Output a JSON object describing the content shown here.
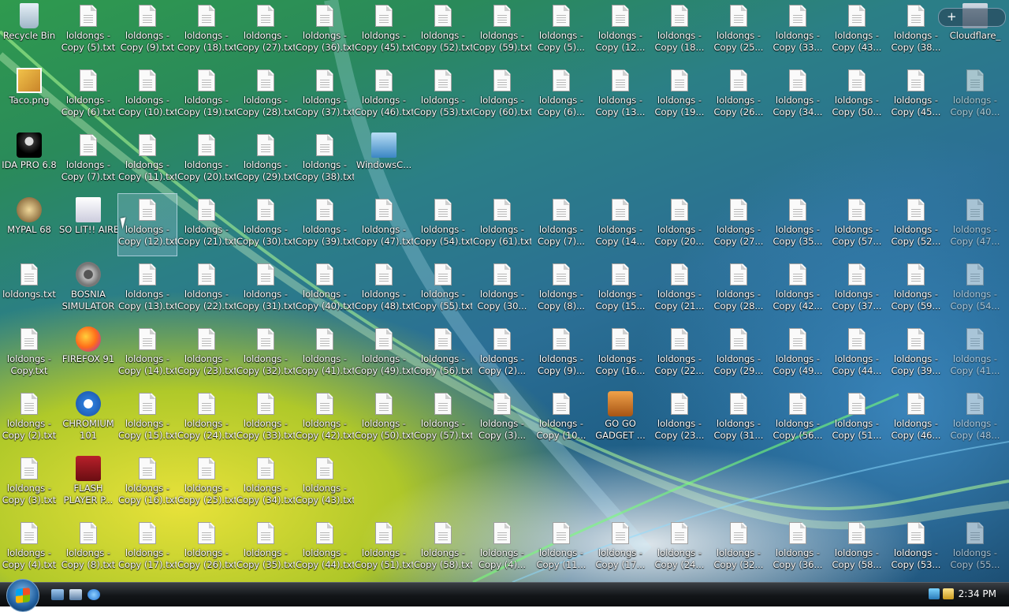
{
  "desktop": {
    "special_icons": [
      {
        "label": "Recycle Bin",
        "icon": "recycle-bin-icon",
        "col": 0,
        "row": 0
      },
      {
        "label": "Taco.png",
        "icon": "taco-image-icon",
        "col": 0,
        "row": 1
      },
      {
        "label": "IDA PRO 6.8",
        "icon": "ida-pro-icon",
        "col": 0,
        "row": 2
      },
      {
        "label": "MYPAL 68",
        "icon": "mypal-browser-icon",
        "col": 0,
        "row": 3
      },
      {
        "label": "SO LIT!! AIRE",
        "icon": "shortcut-app-icon",
        "col": 1,
        "row": 3
      },
      {
        "label": "BOSNIA\nSIMULATOR",
        "icon": "gear-app-icon",
        "col": 1,
        "row": 4
      },
      {
        "label": "FIREFOX 91",
        "icon": "firefox-icon",
        "col": 1,
        "row": 5
      },
      {
        "label": "CHROMIUM\n101",
        "icon": "chromium-icon",
        "col": 1,
        "row": 6
      },
      {
        "label": "FLASH\nPLAYER P...",
        "icon": "flash-player-icon",
        "col": 1,
        "row": 7
      },
      {
        "label": "WindowsC...",
        "icon": "windows-checkmark-icon",
        "col": 6,
        "row": 2
      },
      {
        "label": "GO GO\nGADGET ...",
        "icon": "briefcase-icon",
        "col": 10,
        "row": 6
      },
      {
        "label": "Cloudflare_",
        "icon": "cloudflare-icon",
        "col": 16,
        "row": 0
      }
    ],
    "text_files": [
      [
        "",
        "loldongs -\nCopy (5).txt",
        "loldongs -\nCopy (9).txt",
        "loldongs -\nCopy (18).txt",
        "loldongs -\nCopy (27).txt",
        "loldongs -\nCopy (36).txt",
        "loldongs -\nCopy (45).txt",
        "loldongs -\nCopy (52).txt",
        "loldongs -\nCopy (59).txt",
        "loldongs -\nCopy (5)...",
        "loldongs -\nCopy (12...",
        "loldongs -\nCopy (18...",
        "loldongs -\nCopy (25...",
        "loldongs -\nCopy (33...",
        "loldongs -\nCopy (43...",
        "loldongs -\nCopy (38...",
        ""
      ],
      [
        "",
        "loldongs -\nCopy (6).txt",
        "loldongs -\nCopy (10).txt",
        "loldongs -\nCopy (19).txt",
        "loldongs -\nCopy (28).txt",
        "loldongs -\nCopy (37).txt",
        "loldongs -\nCopy (46).txt",
        "loldongs -\nCopy (53).txt",
        "loldongs -\nCopy (60).txt",
        "loldongs -\nCopy (6)...",
        "loldongs -\nCopy (13...",
        "loldongs -\nCopy (19...",
        "loldongs -\nCopy (26...",
        "loldongs -\nCopy (34...",
        "loldongs -\nCopy (50...",
        "loldongs -\nCopy (45...",
        "loldongs -\nCopy (40..."
      ],
      [
        "",
        "loldongs -\nCopy (7).txt",
        "loldongs -\nCopy (11).txt",
        "loldongs -\nCopy (20).txt",
        "loldongs -\nCopy (29).txt",
        "loldongs -\nCopy (38).txt",
        "",
        "",
        "",
        "",
        "",
        "",
        "",
        "",
        "",
        "",
        ""
      ],
      [
        "",
        "",
        "loldongs -\nCopy (12).txt",
        "loldongs -\nCopy (21).txt",
        "loldongs -\nCopy (30).txt",
        "loldongs -\nCopy (39).txt",
        "loldongs -\nCopy (47).txt",
        "loldongs -\nCopy (54).txt",
        "loldongs -\nCopy (61).txt",
        "loldongs -\nCopy (7)...",
        "loldongs -\nCopy (14...",
        "loldongs -\nCopy (20...",
        "loldongs -\nCopy (27...",
        "loldongs -\nCopy (35...",
        "loldongs -\nCopy (57...",
        "loldongs -\nCopy (52...",
        "loldongs -\nCopy (47..."
      ],
      [
        "loldongs.txt",
        "",
        "loldongs -\nCopy (13).txt",
        "loldongs -\nCopy (22).txt",
        "loldongs -\nCopy (31).txt",
        "loldongs -\nCopy (40).txt",
        "loldongs -\nCopy (48).txt",
        "loldongs -\nCopy (55).txt",
        "loldongs -\nCopy (30...",
        "loldongs -\nCopy (8)...",
        "loldongs -\nCopy (15...",
        "loldongs -\nCopy (21...",
        "loldongs -\nCopy (28...",
        "loldongs -\nCopy (42...",
        "loldongs -\nCopy (37...",
        "loldongs -\nCopy (59...",
        "loldongs -\nCopy (54..."
      ],
      [
        "loldongs -\nCopy.txt",
        "",
        "loldongs -\nCopy (14).txt",
        "loldongs -\nCopy (23).txt",
        "loldongs -\nCopy (32).txt",
        "loldongs -\nCopy (41).txt",
        "loldongs -\nCopy (49).txt",
        "loldongs -\nCopy (56).txt",
        "loldongs -\nCopy (2)...",
        "loldongs -\nCopy (9)...",
        "loldongs -\nCopy (16...",
        "loldongs -\nCopy (22...",
        "loldongs -\nCopy (29...",
        "loldongs -\nCopy (49...",
        "loldongs -\nCopy (44...",
        "loldongs -\nCopy (39...",
        "loldongs -\nCopy (41..."
      ],
      [
        "loldongs -\nCopy (2).txt",
        "",
        "loldongs -\nCopy (15).txt",
        "loldongs -\nCopy (24).txt",
        "loldongs -\nCopy (33).txt",
        "loldongs -\nCopy (42).txt",
        "loldongs -\nCopy (50).txt",
        "loldongs -\nCopy (57).txt",
        "loldongs -\nCopy (3)...",
        "loldongs -\nCopy (10...",
        "",
        "loldongs -\nCopy (23...",
        "loldongs -\nCopy (31...",
        "loldongs -\nCopy (56...",
        "loldongs -\nCopy (51...",
        "loldongs -\nCopy (46...",
        "loldongs -\nCopy (48..."
      ],
      [
        "loldongs -\nCopy (3).txt",
        "",
        "loldongs -\nCopy (16).txt",
        "loldongs -\nCopy (25).txt",
        "loldongs -\nCopy (34).txt",
        "loldongs -\nCopy (43).txt",
        "",
        "",
        "",
        "",
        "",
        "",
        "",
        "",
        "",
        "",
        ""
      ],
      [
        "loldongs -\nCopy (4).txt",
        "loldongs -\nCopy (8).txt",
        "loldongs -\nCopy (17).txt",
        "loldongs -\nCopy (26).txt",
        "loldongs -\nCopy (35).txt",
        "loldongs -\nCopy (44).txt",
        "loldongs -\nCopy (51).txt",
        "loldongs -\nCopy (58).txt",
        "loldongs -\nCopy (4)...",
        "loldongs -\nCopy (11...",
        "loldongs -\nCopy (17...",
        "loldongs -\nCopy (24...",
        "loldongs -\nCopy (32...",
        "loldongs -\nCopy (36...",
        "loldongs -\nCopy (58...",
        "loldongs -\nCopy (53...",
        "loldongs -\nCopy (55..."
      ]
    ],
    "selected": {
      "row": 3,
      "col": 2
    }
  },
  "gadget_bar": {
    "label": "+"
  },
  "taskbar": {
    "start_button": "windows-orb-icon",
    "quick_launch": [
      "show-desktop-icon",
      "switch-windows-icon",
      "internet-explorer-icon"
    ],
    "tray_icons": [
      "network-icon",
      "volume-icon"
    ],
    "clock": "2:34 PM"
  }
}
